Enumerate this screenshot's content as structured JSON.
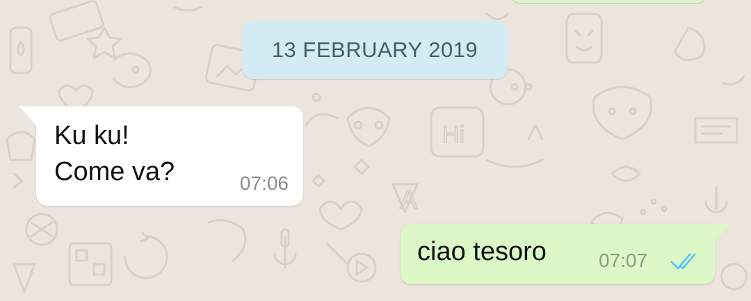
{
  "chat": {
    "date_separator": "13 FEBRUARY 2019",
    "messages": [
      {
        "direction": "incoming",
        "lines": [
          "Ku ku!",
          "Come va?"
        ],
        "time": "07:06"
      },
      {
        "direction": "outgoing",
        "text": "ciao tesoro",
        "time": "07:07",
        "status": "read",
        "status_icon": "double-check-icon"
      }
    ]
  },
  "colors": {
    "wallpaper": "#ece5dd",
    "doodle": "#d9d0c6",
    "incoming_bubble": "#ffffff",
    "outgoing_bubble": "#dcf8c6",
    "date_chip": "#d4eaf4",
    "read_ticks": "#4fc3f7"
  }
}
